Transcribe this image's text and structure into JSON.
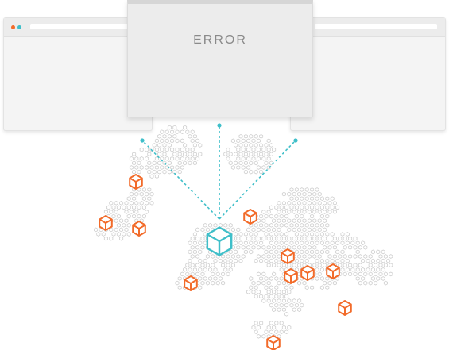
{
  "error_window": {
    "title": "ERROR"
  },
  "colors": {
    "accent_orange": "#f26b2a",
    "accent_teal": "#3fbfc9",
    "dot_close": "#f26b2a",
    "dot_min": "#3fbfc9",
    "hex_outline": "#cfcfcf"
  },
  "icons": {
    "origin": "cube-icon",
    "edge_nodes": "cube-icon"
  }
}
